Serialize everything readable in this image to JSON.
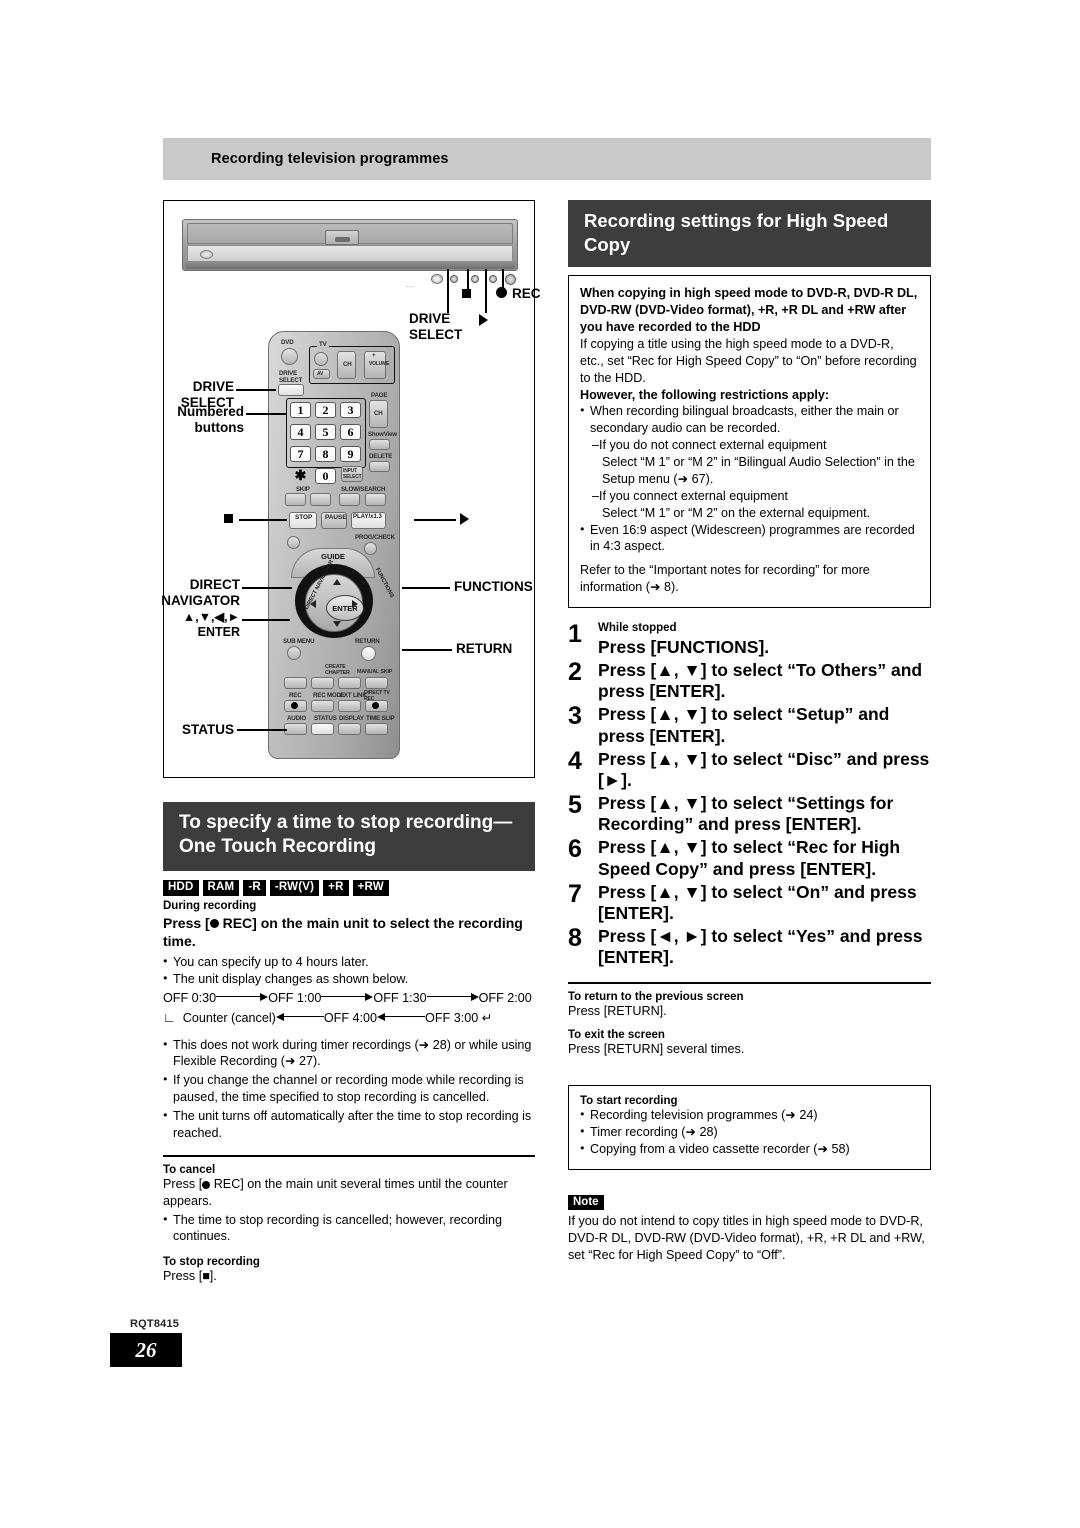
{
  "running_head": "Recording television programmes",
  "footer": {
    "doc_code": "RQT8415",
    "page_number": "26"
  },
  "figure": {
    "device_labels": {
      "drive_select": "DRIVE\nSELECT",
      "stop_glyph": "stop-square",
      "play_glyph": "play-triangle",
      "rec": "REC"
    },
    "remote_labels": {
      "drive_select": "DRIVE\nSELECT",
      "numbered_buttons": "Numbered\nbuttons",
      "stop": "stop-square",
      "play": "play-triangle",
      "direct_navigator": "DIRECT\nNAVIGATOR",
      "arrows_enter": "▲,▼,◄,►\nENTER",
      "status": "STATUS",
      "functions": "FUNCTIONS",
      "return": "RETURN"
    },
    "remote_face": {
      "dvd": "DVD",
      "tv": "TV",
      "av": "AV",
      "ch": "CH",
      "volume": "VOLUME",
      "page": "PAGE",
      "showview": "ShowView",
      "input_select": "INPUT SELECT",
      "delete": "DELETE",
      "skip": "SKIP",
      "slow_search": "SLOW/SEARCH",
      "stop": "STOP",
      "pause": "PAUSE",
      "play": "PLAY/x1.3",
      "prog_check": "PROG/CHECK",
      "guide": "GUIDE",
      "enter": "ENTER",
      "sub_menu": "SUB MENU",
      "return": "RETURN",
      "create_chapter": "CREATE CHAPTER",
      "manual_skip": "MANUAL SKIP",
      "rec": "REC",
      "rec_mode": "REC MODE",
      "ext_link": "EXT LINK",
      "direct_tv_rec": "DIRECT TV REC",
      "audio": "AUDIO",
      "status": "STATUS",
      "display": "DISPLAY",
      "time_slip": "TIME SLIP",
      "numbers": [
        "1",
        "2",
        "3",
        "4",
        "5",
        "6",
        "7",
        "8",
        "9",
        "✱",
        "0"
      ]
    }
  },
  "left_section": {
    "heading": "To specify a time to stop recording— One Touch Recording",
    "badges": [
      "HDD",
      "RAM",
      "-R",
      "-RW(V)",
      "+R",
      "+RW"
    ],
    "condition": "During recording",
    "instruction_prefix": "Press [",
    "instruction_rec": "REC",
    "instruction_suffix": "] on the main unit to select the recording time.",
    "bullets": [
      "You can specify up to 4 hours later.",
      "The unit display changes as shown below."
    ],
    "flow": {
      "row1": [
        "OFF 0:30",
        "OFF 1:00",
        "OFF 1:30",
        "OFF 2:00"
      ],
      "row2": [
        "Counter (cancel)",
        "OFF 4:00",
        "OFF 3:00"
      ]
    },
    "notes": [
      "This does not work during timer recordings (➜ 28) or while using Flexible Recording (➜ 27).",
      "If you change the channel or recording mode while recording is paused, the time specified to stop recording is cancelled.",
      "The unit turns off automatically after the time to stop recording is reached."
    ],
    "to_cancel": {
      "title": "To cancel",
      "text_prefix": "Press [",
      "text_rec": "REC",
      "text_suffix": "] on the main unit several times until the counter appears.",
      "bullet": "The time to stop recording is cancelled; however, recording continues."
    },
    "to_stop": {
      "title": "To stop recording",
      "text": "Press [■]."
    }
  },
  "right_section": {
    "heading": "Recording settings for High Speed Copy",
    "intro_box": {
      "bold_lead": "When copying in high speed mode to DVD-R, DVD-R DL, DVD-RW (DVD-Video format), +R, +R DL and +RW after you have recorded to the HDD",
      "para1": "If copying a title using the high speed mode to a DVD-R, etc., set “Rec for High Speed Copy” to “On” before recording to the HDD.",
      "bold_restrictions": "However, the following restrictions apply:",
      "bullet1": "When recording bilingual broadcasts, either the main or secondary audio can be recorded.",
      "dash1": "–If you do not connect external equipment",
      "dash1_detail": "Select “M 1” or “M 2” in “Bilingual Audio Selection” in the Setup menu (➜ 67).",
      "dash2": "–If you connect external equipment",
      "dash2_detail": "Select “M 1” or “M 2” on the external equipment.",
      "bullet2": "Even 16:9 aspect (Widescreen) programmes are recorded in 4:3 aspect.",
      "para2": "Refer to the “Important notes for recording” for more information (➜ 8)."
    },
    "steps": [
      {
        "num": "1",
        "pre": "While stopped",
        "text": "Press [FUNCTIONS]."
      },
      {
        "num": "2",
        "pre": "",
        "text": "Press [▲, ▼] to select “To Others” and press [ENTER]."
      },
      {
        "num": "3",
        "pre": "",
        "text": "Press [▲, ▼] to select “Setup” and press [ENTER]."
      },
      {
        "num": "4",
        "pre": "",
        "text": "Press [▲, ▼] to select “Disc” and press [►]."
      },
      {
        "num": "5",
        "pre": "",
        "text": "Press [▲, ▼] to select “Settings for Recording” and press [ENTER]."
      },
      {
        "num": "6",
        "pre": "",
        "text": "Press [▲, ▼] to select “Rec for High Speed Copy” and press [ENTER]."
      },
      {
        "num": "7",
        "pre": "",
        "text": "Press [▲, ▼] to select “On” and press [ENTER]."
      },
      {
        "num": "8",
        "pre": "",
        "text": "Press [◄, ►] to select “Yes” and press [ENTER]."
      }
    ],
    "to_return": {
      "title": "To return to the previous screen",
      "text": "Press [RETURN]."
    },
    "to_exit": {
      "title": "To exit the screen",
      "text": "Press [RETURN] several times."
    },
    "start_recording_box": {
      "title": "To start recording",
      "items": [
        "Recording television programmes (➜ 24)",
        "Timer recording (➜ 28)",
        "Copying from a video cassette recorder (➜ 58)"
      ]
    },
    "note": {
      "tag": "Note",
      "text": "If you do not intend to copy titles in high speed mode to DVD-R, DVD-R DL, DVD-RW (DVD-Video format), +R, +R DL and +RW, set “Rec for High Speed Copy” to “Off”."
    }
  }
}
